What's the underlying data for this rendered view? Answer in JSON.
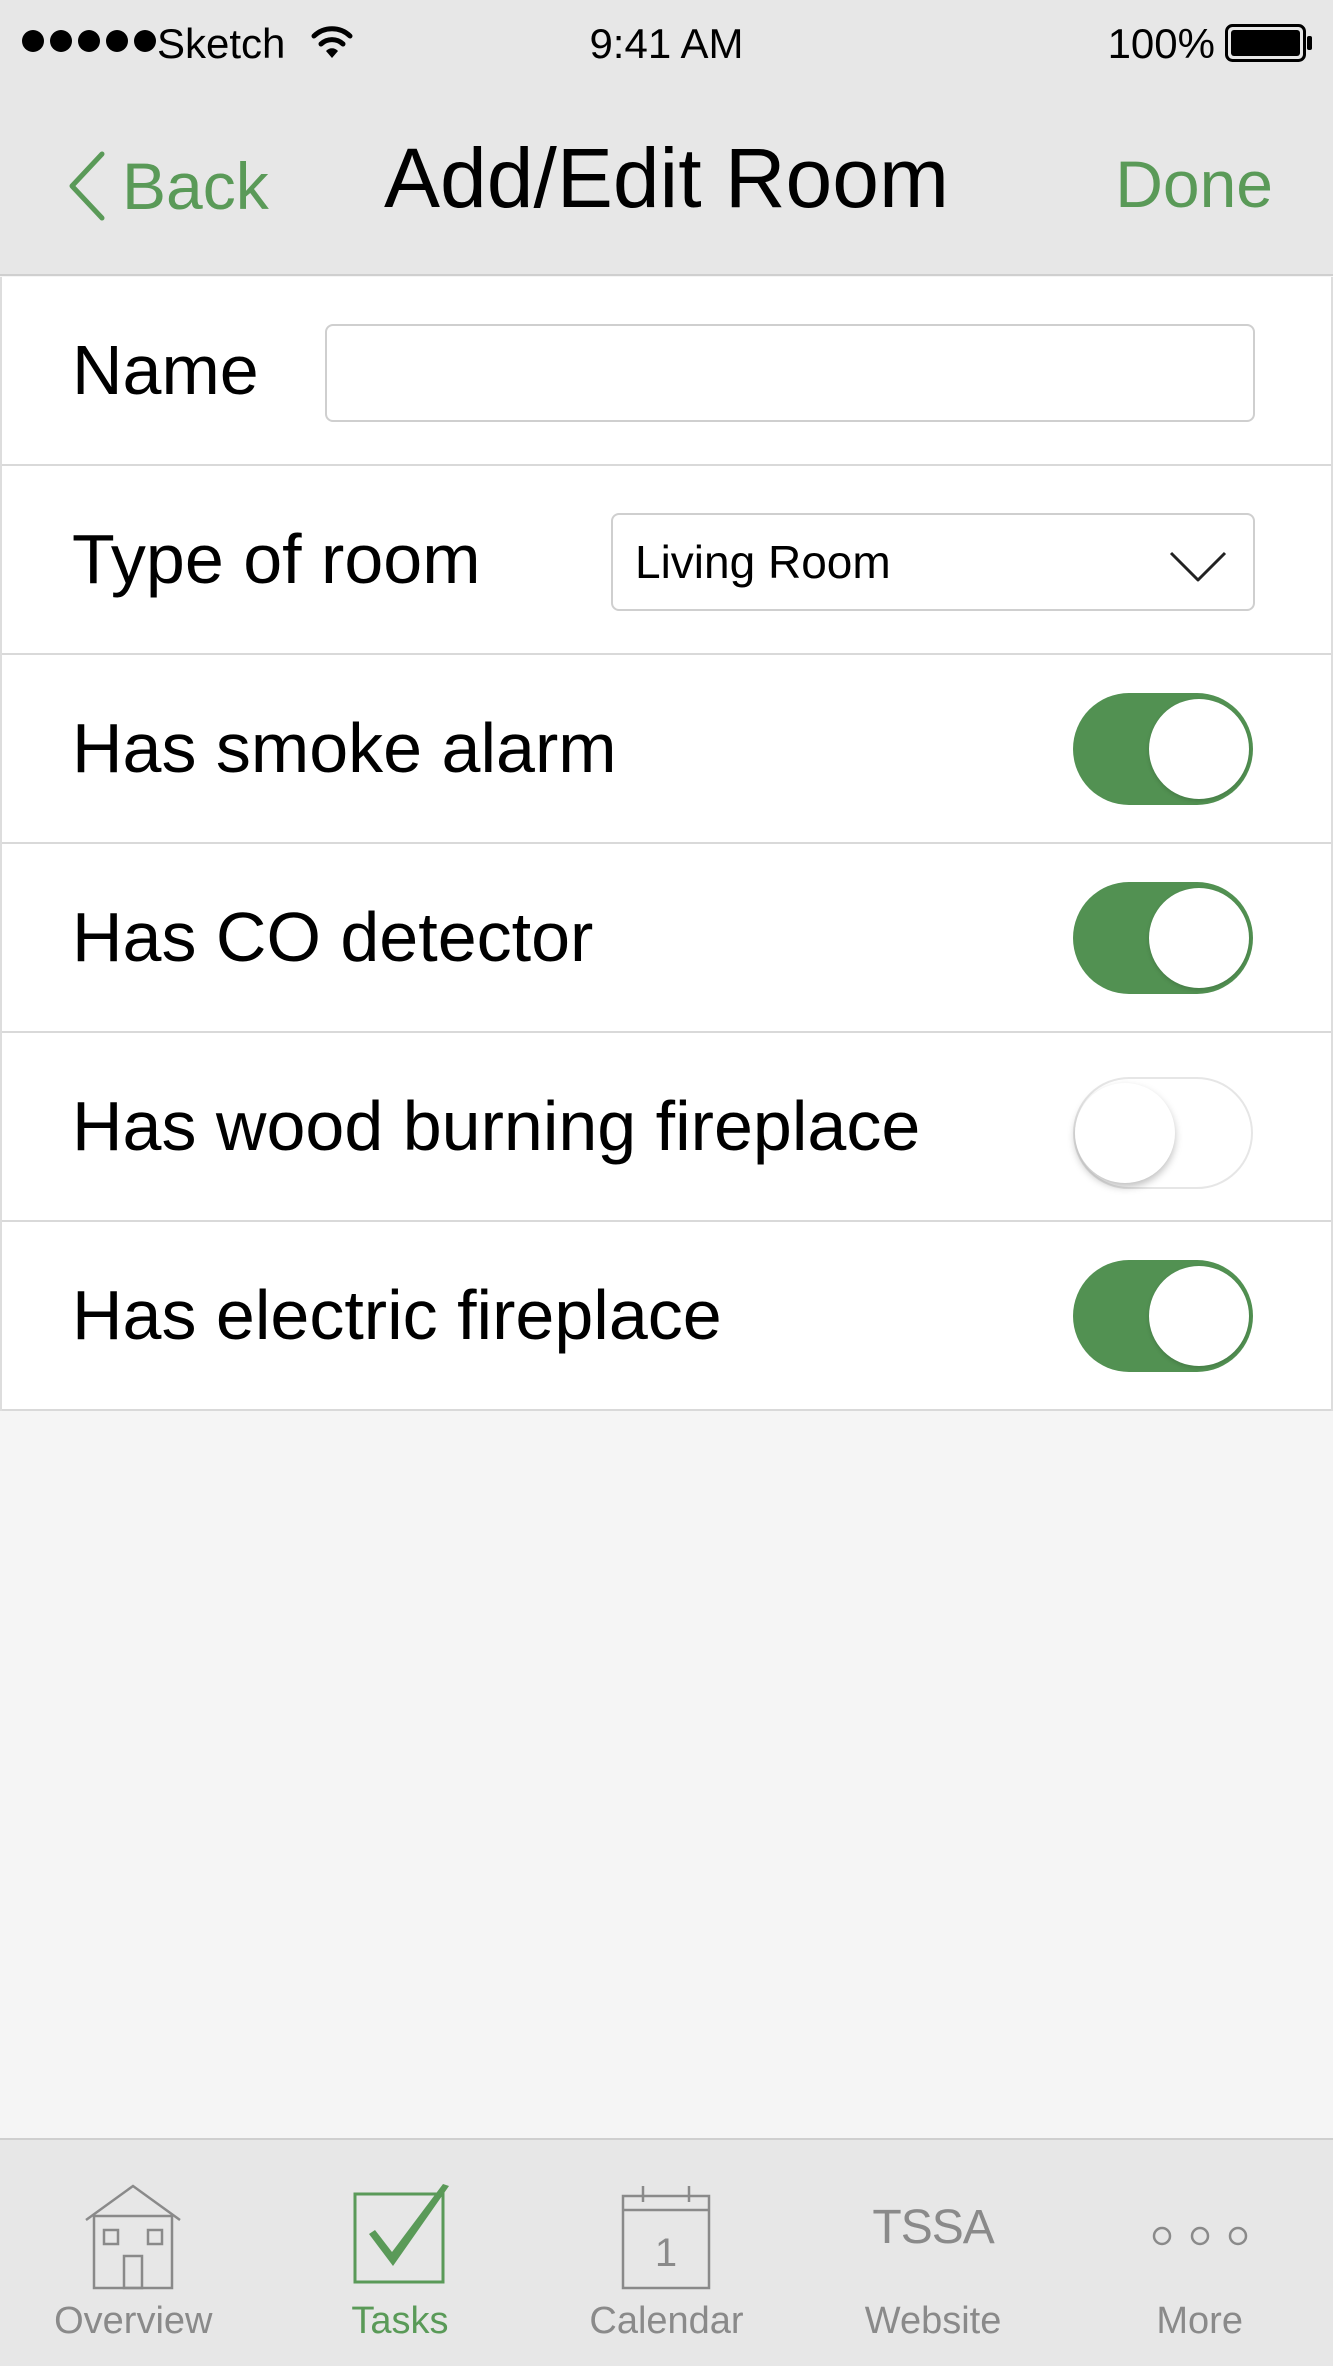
{
  "status_bar": {
    "carrier": "Sketch",
    "time": "9:41 AM",
    "battery_percent": "100%"
  },
  "nav": {
    "back_label": "Back",
    "title": "Add/Edit Room",
    "done_label": "Done"
  },
  "form": {
    "name": {
      "label": "Name",
      "value": "",
      "placeholder": ""
    },
    "room_type": {
      "label": "Type of room",
      "selected": "Living Room"
    },
    "toggles": [
      {
        "label": "Has smoke alarm",
        "on": true
      },
      {
        "label": "Has CO detector",
        "on": true
      },
      {
        "label": "Has wood burning fireplace",
        "on": false
      },
      {
        "label": "Has electric fireplace",
        "on": true
      }
    ]
  },
  "tab_bar": {
    "tabs": [
      {
        "label": "Overview",
        "icon": "house-icon",
        "active": false
      },
      {
        "label": "Tasks",
        "icon": "checkbox-icon",
        "active": true
      },
      {
        "label": "Calendar",
        "icon": "calendar-icon",
        "active": false,
        "icon_text": "1"
      },
      {
        "label": "Website",
        "icon": "tssa-logo-icon",
        "active": false,
        "icon_text": "TSSA"
      },
      {
        "label": "More",
        "icon": "more-dots-icon",
        "active": false
      }
    ]
  },
  "colors": {
    "accent": "#5a9a58",
    "toggle_on": "#529152",
    "bar_background": "#e7e7e7",
    "page_background": "#f5f5f5"
  }
}
